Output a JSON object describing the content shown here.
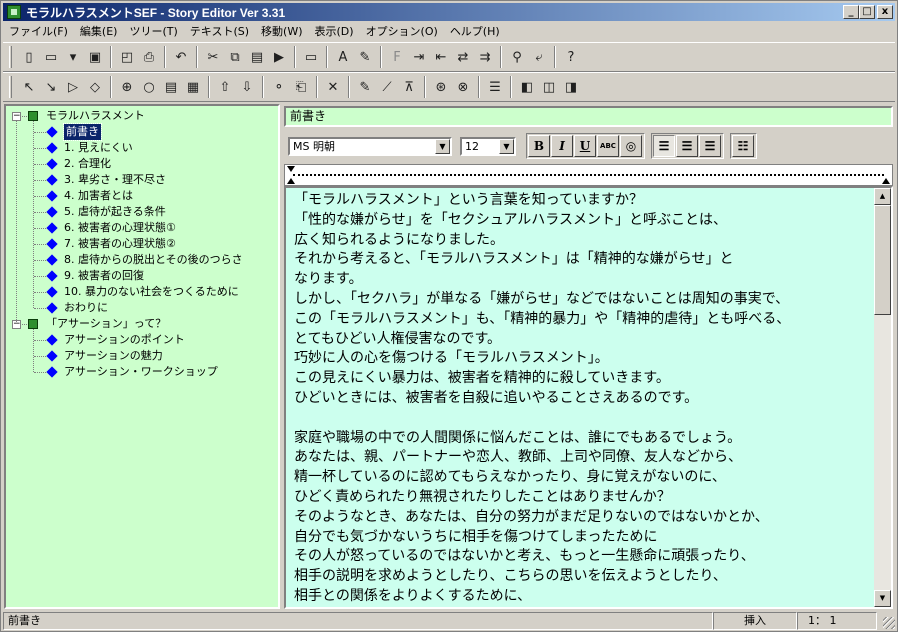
{
  "window": {
    "title": "モラルハラスメントSEF - Story Editor Ver 3.31",
    "controls": {
      "minimize": "_",
      "maximize": "□",
      "close": "x"
    }
  },
  "menu": [
    "ファイル(F)",
    "編集(E)",
    "ツリー(T)",
    "テキスト(S)",
    "移動(W)",
    "表示(D)",
    "オプション(O)",
    "ヘルプ(H)"
  ],
  "toolbar1": [
    {
      "icon": "new-file-icon",
      "glyph": "▯"
    },
    {
      "icon": "open-folder-icon",
      "glyph": "▭"
    },
    {
      "icon": "dropdown-icon",
      "glyph": "▾"
    },
    {
      "icon": "save-icon",
      "glyph": "▣"
    },
    {
      "icon": "print-preview-icon",
      "glyph": "◰"
    },
    {
      "icon": "print-icon",
      "glyph": "⎙"
    },
    {
      "icon": "undo-icon",
      "glyph": "↶"
    },
    {
      "icon": "cut-icon",
      "glyph": "✂"
    },
    {
      "icon": "copy-icon",
      "glyph": "⧉"
    },
    {
      "icon": "paste-icon",
      "glyph": "▤"
    },
    {
      "icon": "paste-special-icon",
      "glyph": "▶"
    },
    {
      "icon": "window-icon",
      "glyph": "▭"
    },
    {
      "icon": "font-a-icon",
      "glyph": "A"
    },
    {
      "icon": "pen-icon",
      "glyph": "✎"
    },
    {
      "icon": "format-f-icon",
      "glyph": "F"
    },
    {
      "icon": "find-next-icon",
      "glyph": "⇥"
    },
    {
      "icon": "find-prev-icon",
      "glyph": "⇤"
    },
    {
      "icon": "replace-icon",
      "glyph": "⇄"
    },
    {
      "icon": "replace-all-icon",
      "glyph": "⇉"
    },
    {
      "icon": "binoculars-icon",
      "glyph": "⚲"
    },
    {
      "icon": "jump-icon",
      "glyph": "⤶"
    },
    {
      "icon": "help-icon",
      "glyph": "?"
    }
  ],
  "toolbar2": [
    {
      "icon": "pointer-up-icon",
      "glyph": "↖"
    },
    {
      "icon": "pointer-down-icon",
      "glyph": "↘"
    },
    {
      "icon": "play-icon",
      "glyph": "▷"
    },
    {
      "icon": "diamond-icon",
      "glyph": "◇"
    },
    {
      "icon": "zoom-in-icon",
      "glyph": "⊕"
    },
    {
      "icon": "zoom-out-icon",
      "glyph": "○"
    },
    {
      "icon": "outline-icon",
      "glyph": "▤"
    },
    {
      "icon": "insert-icon",
      "glyph": "▦"
    },
    {
      "icon": "move-up-icon",
      "glyph": "⇧"
    },
    {
      "icon": "move-down-icon",
      "glyph": "⇩"
    },
    {
      "icon": "node-icon",
      "glyph": "⚬"
    },
    {
      "icon": "attach-icon",
      "glyph": "⎗"
    },
    {
      "icon": "delete-icon",
      "glyph": "✕"
    },
    {
      "icon": "edit-node-icon",
      "glyph": "✎"
    },
    {
      "icon": "pen-line-icon",
      "glyph": "⟋"
    },
    {
      "icon": "strike-icon",
      "glyph": "⊼"
    },
    {
      "icon": "check-icon",
      "glyph": "⊛"
    },
    {
      "icon": "check-all-icon",
      "glyph": "⊗"
    },
    {
      "icon": "list-icon",
      "glyph": "☰"
    },
    {
      "icon": "layout-left-icon",
      "glyph": "◧"
    },
    {
      "icon": "layout-split-icon",
      "glyph": "◫"
    },
    {
      "icon": "layout-right-icon",
      "glyph": "◨"
    }
  ],
  "tree": {
    "root1": "モラルハラスメント",
    "items1": [
      "前書き",
      "1. 見えにくい",
      "2. 合理化",
      "3. 卑劣さ・理不尽さ",
      "4. 加害者とは",
      "5. 虐待が起きる条件",
      "6. 被害者の心理状態①",
      "7. 被害者の心理状態②",
      "8. 虐待からの脱出とその後のつらさ",
      "9. 被害者の回復",
      "10. 暴力のない社会をつくるために",
      "おわりに"
    ],
    "root2": "「アサーション」って？",
    "items2": [
      "アサーションのポイント",
      "アサーションの魅力",
      "アサーション・ワークショップ"
    ],
    "selected_index": 0,
    "expander": "−"
  },
  "heading": "前書き",
  "format": {
    "font": "MS 明朝",
    "size": "12",
    "bold": "B",
    "italic": "I",
    "underline": "U",
    "abc": "ABC"
  },
  "editor": {
    "lines": [
      "「モラルハラスメント」という言葉を知っていますか？",
      "「性的な嫌がらせ」を「セクシュアルハラスメント」と呼ぶことは、",
      "広く知られるようになりました。",
      "それから考えると、「モラルハラスメント」は「精神的な嫌がらせ」と",
      "なります。",
      "しかし、「セクハラ」が単なる「嫌がらせ」などではないことは周知の事実で、",
      "この「モラルハラスメント」も、「精神的暴力」や「精神的虐待」とも呼べる、",
      "とてもひどい人権侵害なのです。",
      "巧妙に人の心を傷つける「モラルハラスメント」。",
      "この見えにくい暴力は、被害者を精神的に殺していきます。",
      "ひどいときには、被害者を自殺に追いやることさえあるのです。",
      "",
      "家庭や職場の中での人間関係に悩んだことは、誰にでもあるでしょう。",
      "あなたは、親、パートナーや恋人、教師、上司や同僚、友人などから、",
      "精一杯しているのに認めてもらえなかったり、身に覚えがないのに、",
      "ひどく責められたり無視されたりしたことはありませんか？",
      "そのようなとき、あなたは、自分の努力がまだ足りないのではないかとか、",
      "自分でも気づかないうちに相手を傷つけてしまったために",
      "その人が怒っているのではないかと考え、もっと一生懸命に頑張ったり、",
      "相手の説明を求めようとしたり、こちらの思いを伝えようとしたり、",
      "相手との関係をよりよくするために、"
    ]
  },
  "status": {
    "section": "前書き",
    "mode": "挿入",
    "position": "1： 1"
  },
  "colors": {
    "tree_bg": "#ccffcc",
    "editor_bg": "#ccffee",
    "title_start": "#0a246a",
    "title_end": "#a6caf0",
    "bullet": "#0000ff",
    "folder": "#2f8f2f"
  }
}
